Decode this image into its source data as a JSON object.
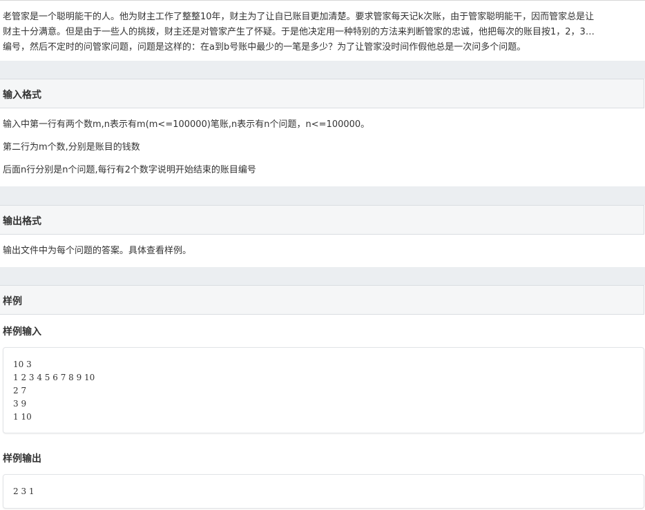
{
  "description": {
    "lines": [
      "老管家是一个聪明能干的人。他为财主工作了整整10年，财主为了让自已账目更加清楚。要求管家每天记k次账，由于管家聪明能干，因而管家总是让",
      "财主十分满意。但是由于一些人的挑拨，财主还是对管家产生了怀疑。于是他决定用一种特别的方法来判断管家的忠诚，他把每次的账目按1，2，3…",
      "编号，然后不定时的问管家问题，问题是这样的：在a到b号账中最少的一笔是多少？为了让管家没时间作假他总是一次问多个问题。"
    ]
  },
  "input_format": {
    "title": "输入格式",
    "lines": [
      "输入中第一行有两个数m,n表示有m(m<=100000)笔账,n表示有n个问题，n<=100000。",
      "第二行为m个数,分别是账目的钱数",
      "后面n行分别是n个问题,每行有2个数字说明开始结束的账目编号"
    ]
  },
  "output_format": {
    "title": "输出格式",
    "lines": [
      "输出文件中为每个问题的答案。具体查看样例。"
    ]
  },
  "sample": {
    "title": "样例",
    "input_title": "样例输入",
    "input_lines": [
      "10 3",
      "1 2 3 4 5 6 7 8 9 10",
      "2 7",
      "3 9",
      "1 10"
    ],
    "output_title": "样例输出",
    "output_lines": [
      "2 3 1"
    ]
  }
}
